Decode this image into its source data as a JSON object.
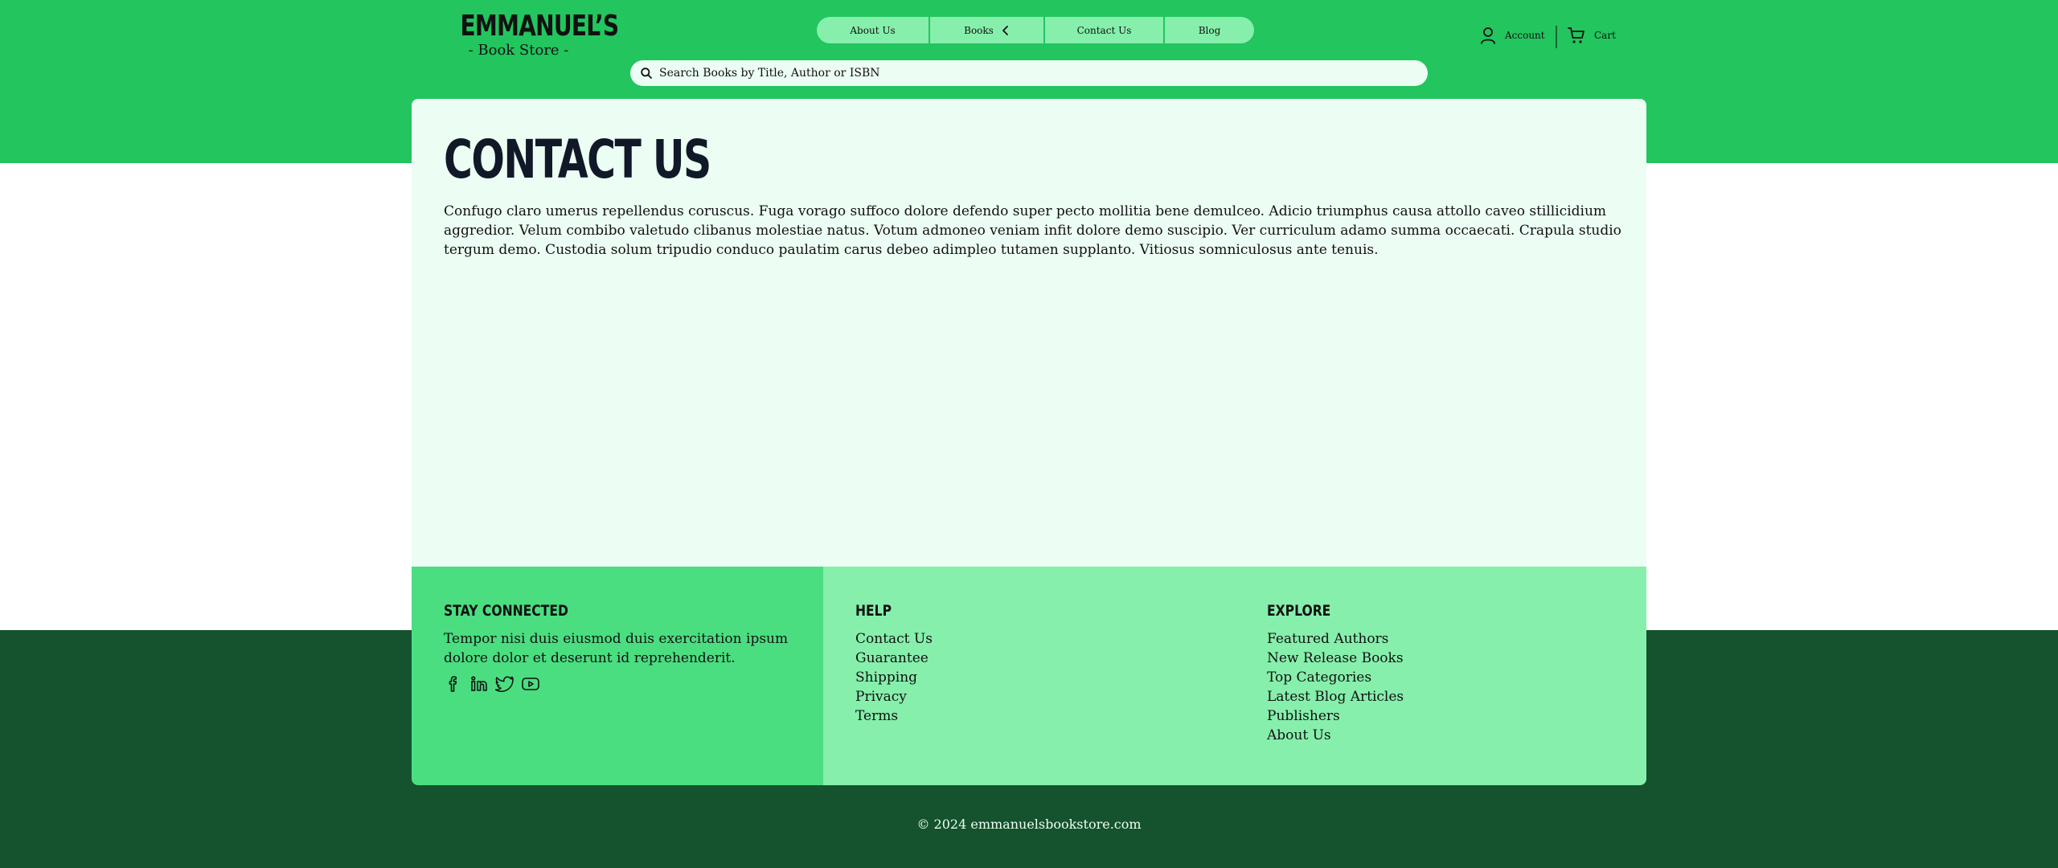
{
  "brand": {
    "name": "EMMANUEL’S",
    "tagline": "- Book Store -"
  },
  "nav": {
    "items": [
      {
        "label": "About Us"
      },
      {
        "label": "Books"
      },
      {
        "label": "Contact Us"
      },
      {
        "label": "Blog"
      }
    ]
  },
  "search": {
    "placeholder": "Search Books by Title, Author or ISBN",
    "icon": "search-icon"
  },
  "header_actions": {
    "account_label": "Account",
    "cart_label": "Cart"
  },
  "main": {
    "title": "CONTACT US",
    "body": "Confugo claro umerus repellendus coruscus. Fuga vorago suffoco dolore defendo super pecto mollitia bene demulceo. Adicio triumphus causa attollo caveo stillicidium aggredior. Velum combibo valetudo clibanus molestiae natus. Votum admoneo veniam infit dolore demo suscipio. Ver curriculum adamo summa occaecati. Crapula studio tergum demo. Custodia solum tripudio conduco paulatim carus debeo adimpleo tutamen supplanto. Vitiosus somniculosus ante tenuis."
  },
  "footer": {
    "stay_connected": {
      "heading": "STAY CONNECTED",
      "text": "Tempor nisi duis eiusmod duis exercitation ipsum dolore dolor et deserunt id reprehenderit.",
      "socials": [
        "facebook-icon",
        "linkedin-icon",
        "twitter-icon",
        "youtube-icon"
      ]
    },
    "help": {
      "heading": "HELP",
      "links": [
        "Contact Us",
        "Guarantee",
        "Shipping",
        "Privacy",
        "Terms"
      ]
    },
    "explore": {
      "heading": "EXPLORE",
      "links": [
        "Featured Authors",
        "New Release Books",
        "Top Categories",
        "Latest Blog Articles",
        "Publishers",
        "About Us"
      ]
    },
    "copyright": "© 2024 emmanuelsbookstore.com"
  },
  "colors": {
    "header_green": "#22c55e",
    "nav_pill": "#86efac",
    "card_bg": "#ecfdf3",
    "footer_accent": "#4ade80",
    "footer_light": "#86efac",
    "bottom_dark": "#14532d"
  }
}
